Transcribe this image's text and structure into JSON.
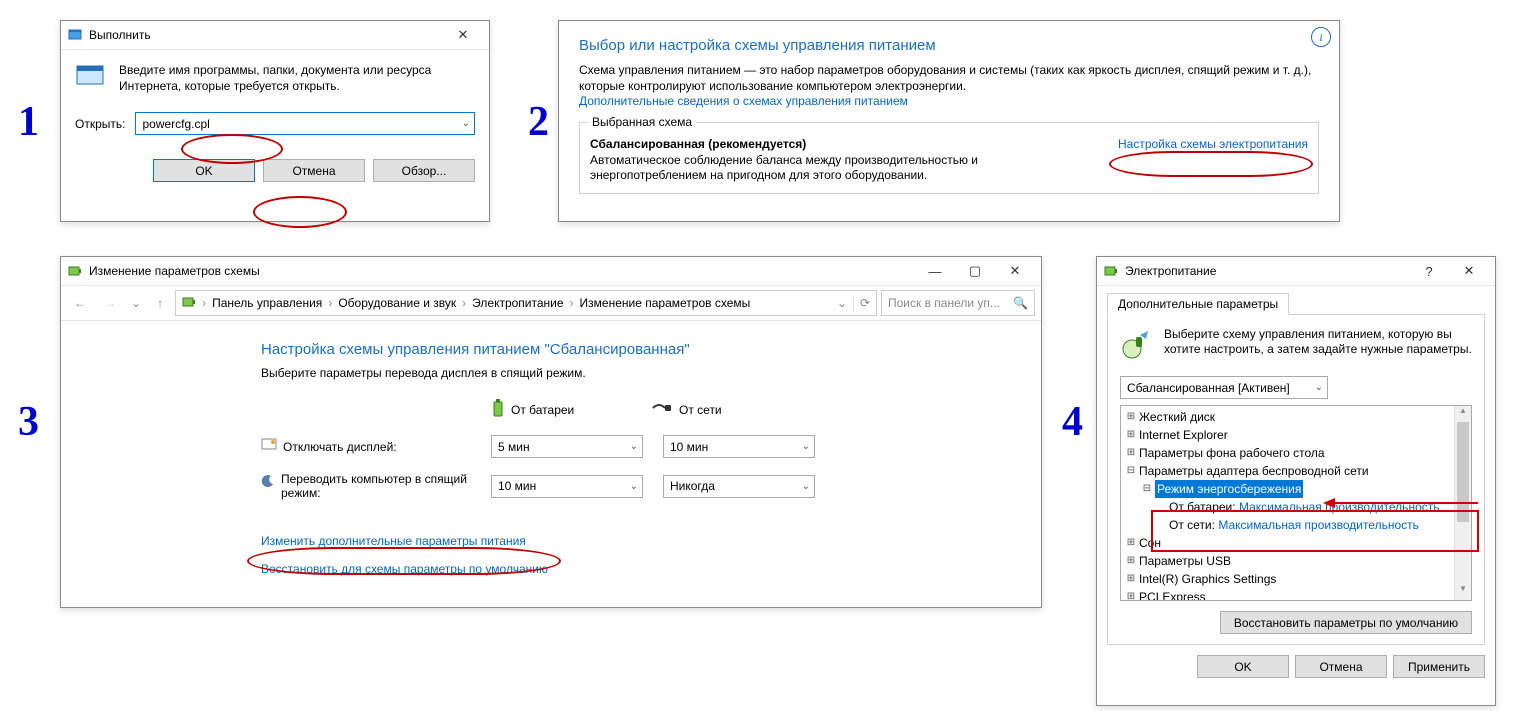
{
  "step_labels": [
    "1",
    "2",
    "3",
    "4"
  ],
  "run": {
    "title": "Выполнить",
    "instruction": "Введите имя программы, папки, документа или ресурса Интернета, которые требуется открыть.",
    "open_label": "Открыть:",
    "command": "powercfg.cpl",
    "ok": "OK",
    "cancel": "Отмена",
    "browse": "Обзор..."
  },
  "power": {
    "heading": "Выбор или настройка схемы управления питанием",
    "desc": "Схема управления питанием — это набор параметров оборудования и системы (таких как яркость дисплея, спящий режим и т. д.), которые контролируют использование компьютером электроэнергии.",
    "more_link": "Дополнительные сведения о схемах управления питанием",
    "fieldset_label": "Выбранная схема",
    "plan_name": "Сбалансированная (рекомендуется)",
    "plan_desc": "Автоматическое соблюдение баланса между производительностью и энергопотреблением на пригодном для этого оборудовании.",
    "settings_link": "Настройка схемы электропитания"
  },
  "edit": {
    "title": "Изменение параметров схемы",
    "breadcrumbs": [
      "Панель управления",
      "Оборудование и звук",
      "Электропитание",
      "Изменение параметров схемы"
    ],
    "search_placeholder": "Поиск в панели уп...",
    "heading": "Настройка схемы управления питанием \"Сбалансированная\"",
    "subheading": "Выберите параметры перевода дисплея в спящий режим.",
    "col_battery": "От батареи",
    "col_plugged": "От сети",
    "row_display": "Отключать дисплей:",
    "row_sleep": "Переводить компьютер в спящий режим:",
    "display_battery": "5 мин",
    "display_plugged": "10 мин",
    "sleep_battery": "10 мин",
    "sleep_plugged": "Никогда",
    "adv_link": "Изменить дополнительные параметры питания",
    "restore_link": "Восстановить для схемы параметры по умолчанию"
  },
  "adv": {
    "title": "Электропитание",
    "tab": "Дополнительные параметры",
    "intro": "Выберите схему управления питанием, которую вы хотите настроить, а затем задайте нужные параметры.",
    "plan_selected": "Сбалансированная [Активен]",
    "tree": {
      "hdd": "Жесткий диск",
      "ie": "Internet Explorer",
      "desk": "Параметры фона рабочего стола",
      "wifi": "Параметры адаптера беспроводной сети",
      "mode": "Режим энергосбережения",
      "battery_label": "От батареи:",
      "plugged_label": "От сети:",
      "battery_val": "Максимальная производительность",
      "plugged_val": "Максимальная производительность",
      "sleep": "Сон",
      "usb": "Параметры USB",
      "gfx": "Intel(R) Graphics Settings",
      "pci": "PCI Express"
    },
    "restore": "Восстановить параметры по умолчанию",
    "ok": "OK",
    "cancel": "Отмена",
    "apply": "Применить"
  }
}
